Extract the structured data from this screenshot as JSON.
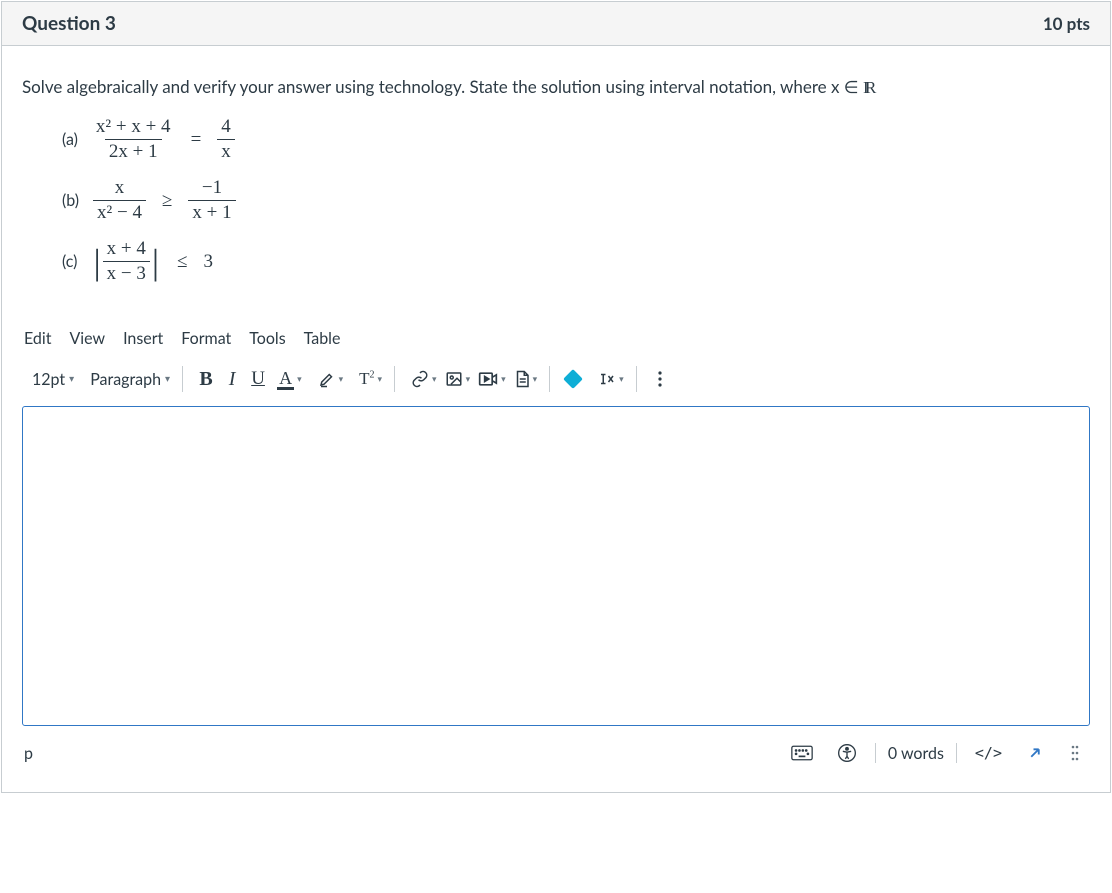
{
  "header": {
    "title": "Question 3",
    "points": "10 pts"
  },
  "prompt": "Solve algebraically and verify your answer using technology. State the solution using interval notation, where x ∈ ",
  "parts": {
    "a": {
      "label": "(a)",
      "lhs_num": "x² + x + 4",
      "lhs_den": "2x + 1",
      "op": "=",
      "rhs_num": "4",
      "rhs_den": "x"
    },
    "b": {
      "label": "(b)",
      "lhs_num": "x",
      "lhs_den": "x² − 4",
      "op": "≥",
      "rhs_num": "−1",
      "rhs_den": "x + 1"
    },
    "c": {
      "label": "(c)",
      "inner_num": "x + 4",
      "inner_den": "x − 3",
      "op": "≤",
      "rhs": "3"
    }
  },
  "menu": {
    "edit": "Edit",
    "view": "View",
    "insert": "Insert",
    "format": "Format",
    "tools": "Tools",
    "table": "Table"
  },
  "toolbar": {
    "font_size": "12pt",
    "block": "Paragraph",
    "bold": "B",
    "italic": "I",
    "underline": "U",
    "textcolor": "A",
    "highlight": "✎",
    "supersub": "T²",
    "link": "link",
    "image": "image",
    "media": "media",
    "doc": "document",
    "apps": "apps",
    "equation": "equation",
    "more": "⋮"
  },
  "status": {
    "path": "p",
    "keyboard": "keyboard-icon",
    "a11y": "accessibility-icon",
    "words": "0 words",
    "html": "</>",
    "fullscreen": "↗",
    "drag": "⋮⋮"
  }
}
